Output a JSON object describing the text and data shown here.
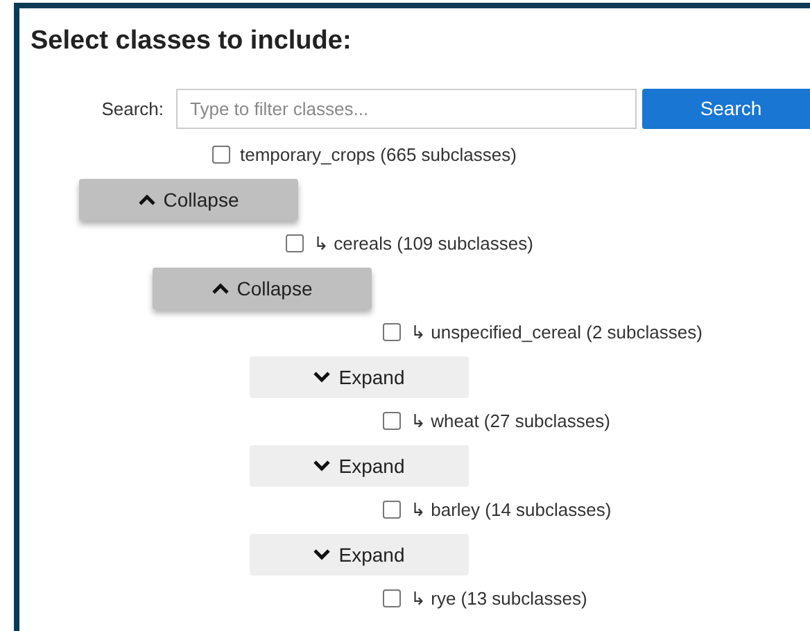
{
  "title": "Select classes to include:",
  "search": {
    "label": "Search:",
    "placeholder": "Type to filter classes...",
    "button": "Search"
  },
  "tree": [
    {
      "label": "temporary_crops (665 subclasses)",
      "checked": false,
      "toggle": {
        "label": "Collapse",
        "expanded": true
      },
      "children": [
        {
          "label": "↳ cereals (109 subclasses)",
          "checked": false,
          "toggle": {
            "label": "Collapse",
            "expanded": true
          },
          "children": [
            {
              "label": "↳ unspecified_cereal (2 subclasses)",
              "checked": false,
              "toggle": {
                "label": "Expand",
                "expanded": false
              }
            },
            {
              "label": "↳ wheat (27 subclasses)",
              "checked": false,
              "toggle": {
                "label": "Expand",
                "expanded": false
              }
            },
            {
              "label": "↳ barley (14 subclasses)",
              "checked": false,
              "toggle": {
                "label": "Expand",
                "expanded": false
              }
            },
            {
              "label": "↳ rye (13 subclasses)",
              "checked": false
            }
          ]
        }
      ]
    }
  ]
}
